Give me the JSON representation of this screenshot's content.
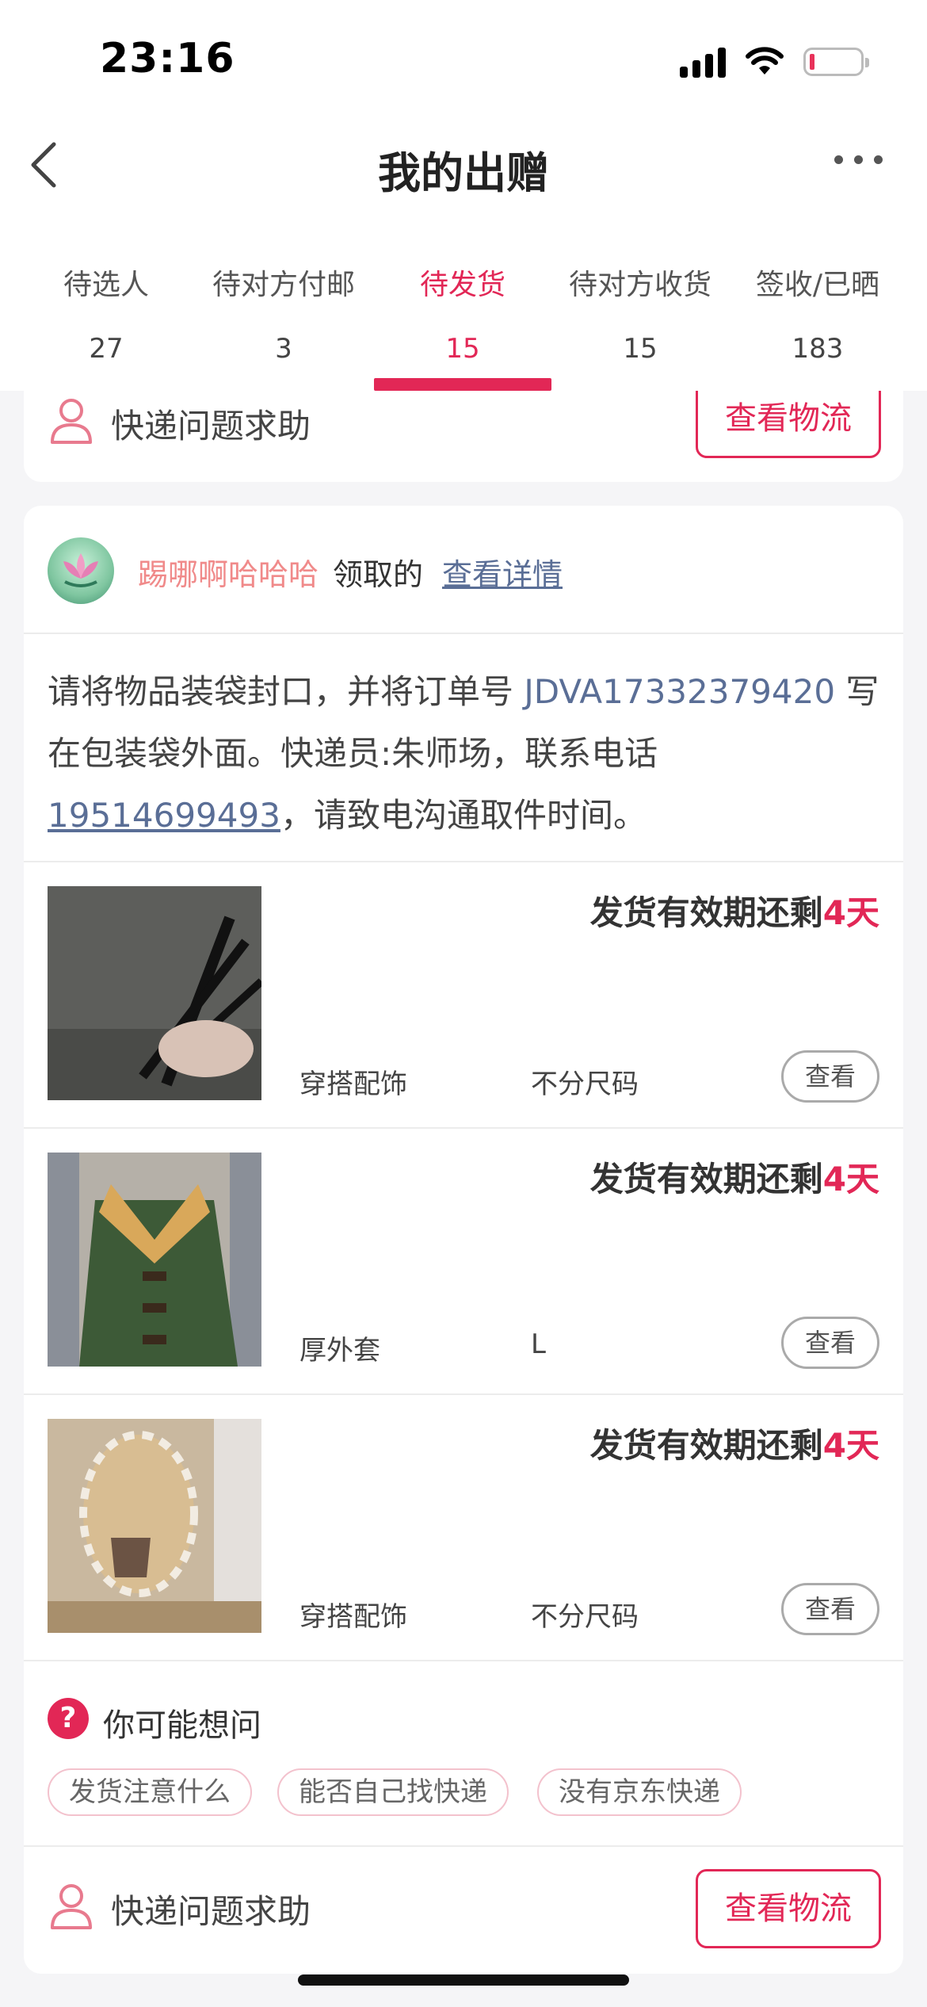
{
  "status_bar": {
    "time": "23:16"
  },
  "nav": {
    "title": "我的出赠"
  },
  "tabs": [
    {
      "label": "待选人",
      "count": "27"
    },
    {
      "label": "待对方付邮",
      "count": "3"
    },
    {
      "label": "待发货",
      "count": "15",
      "active": true
    },
    {
      "label": "待对方收货",
      "count": "15"
    },
    {
      "label": "签收/已晒",
      "count": "183"
    }
  ],
  "top_card": {
    "help_label": "快递问题求助",
    "logistics_button": "查看物流"
  },
  "order": {
    "claimer_name": "踢哪啊哈哈哈",
    "claimer_suffix": "领取的",
    "details_link": "查看详情",
    "instruction_1": "请将物品装袋封口，并将订单号 ",
    "order_number": "JDVA17332379420",
    "instruction_2": " 写在包装袋外面。快递员:朱师场，联系电话",
    "phone": "19514699493",
    "instruction_3": "，请致电沟通取件时间。",
    "items": [
      {
        "deadline_prefix": "发货有效期还剩",
        "deadline_days": "4天",
        "category": "穿搭配饰",
        "size": "不分尺码",
        "view": "查看"
      },
      {
        "deadline_prefix": "发货有效期还剩",
        "deadline_days": "4天",
        "category": "厚外套",
        "size": "L",
        "view": "查看"
      },
      {
        "deadline_prefix": "发货有效期还剩",
        "deadline_days": "4天",
        "category": "穿搭配饰",
        "size": "不分尺码",
        "view": "查看"
      }
    ],
    "faq": {
      "icon": "?",
      "title": "你可能想问",
      "chips": [
        "发货注意什么",
        "能否自己找快递",
        "没有京东快递"
      ]
    },
    "help_label": "快递问题求助",
    "logistics_button": "查看物流"
  },
  "colors": {
    "accent": "#e22756",
    "link": "#5a6e96",
    "name": "#f08a8a"
  }
}
